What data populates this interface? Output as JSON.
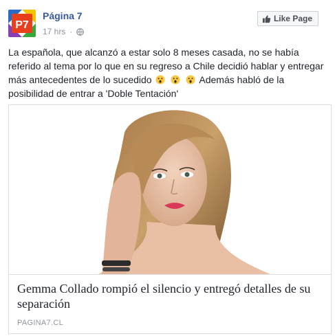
{
  "post": {
    "page_name": "Página 7",
    "avatar_text": "P7",
    "time": "17 hrs",
    "dot": "·",
    "like_button_label": "Like Page",
    "text_part1": "La española, que alcanzó a estar solo 8 meses casada, no se había referido al tema por lo que en su regreso a Chile decidió hablar y entregar más antecedentes de lo sucedido",
    "text_part2": "Además habló de la posibilidad de entrar a 'Doble Tentación'",
    "emojis": [
      "astonished-face-icon",
      "astonished-face-icon",
      "astonished-face-icon"
    ]
  },
  "link": {
    "title": "Gemma Collado rompió el silencio y entregó detalles de su separación",
    "domain": "PAGINA7.CL"
  },
  "colors": {
    "link_blue": "#365899",
    "meta_gray": "#90949c",
    "avatar_red": "#e8401c",
    "avatar_yellow": "#f5c400",
    "avatar_green": "#37a93c",
    "avatar_blue": "#2a6cc4"
  }
}
